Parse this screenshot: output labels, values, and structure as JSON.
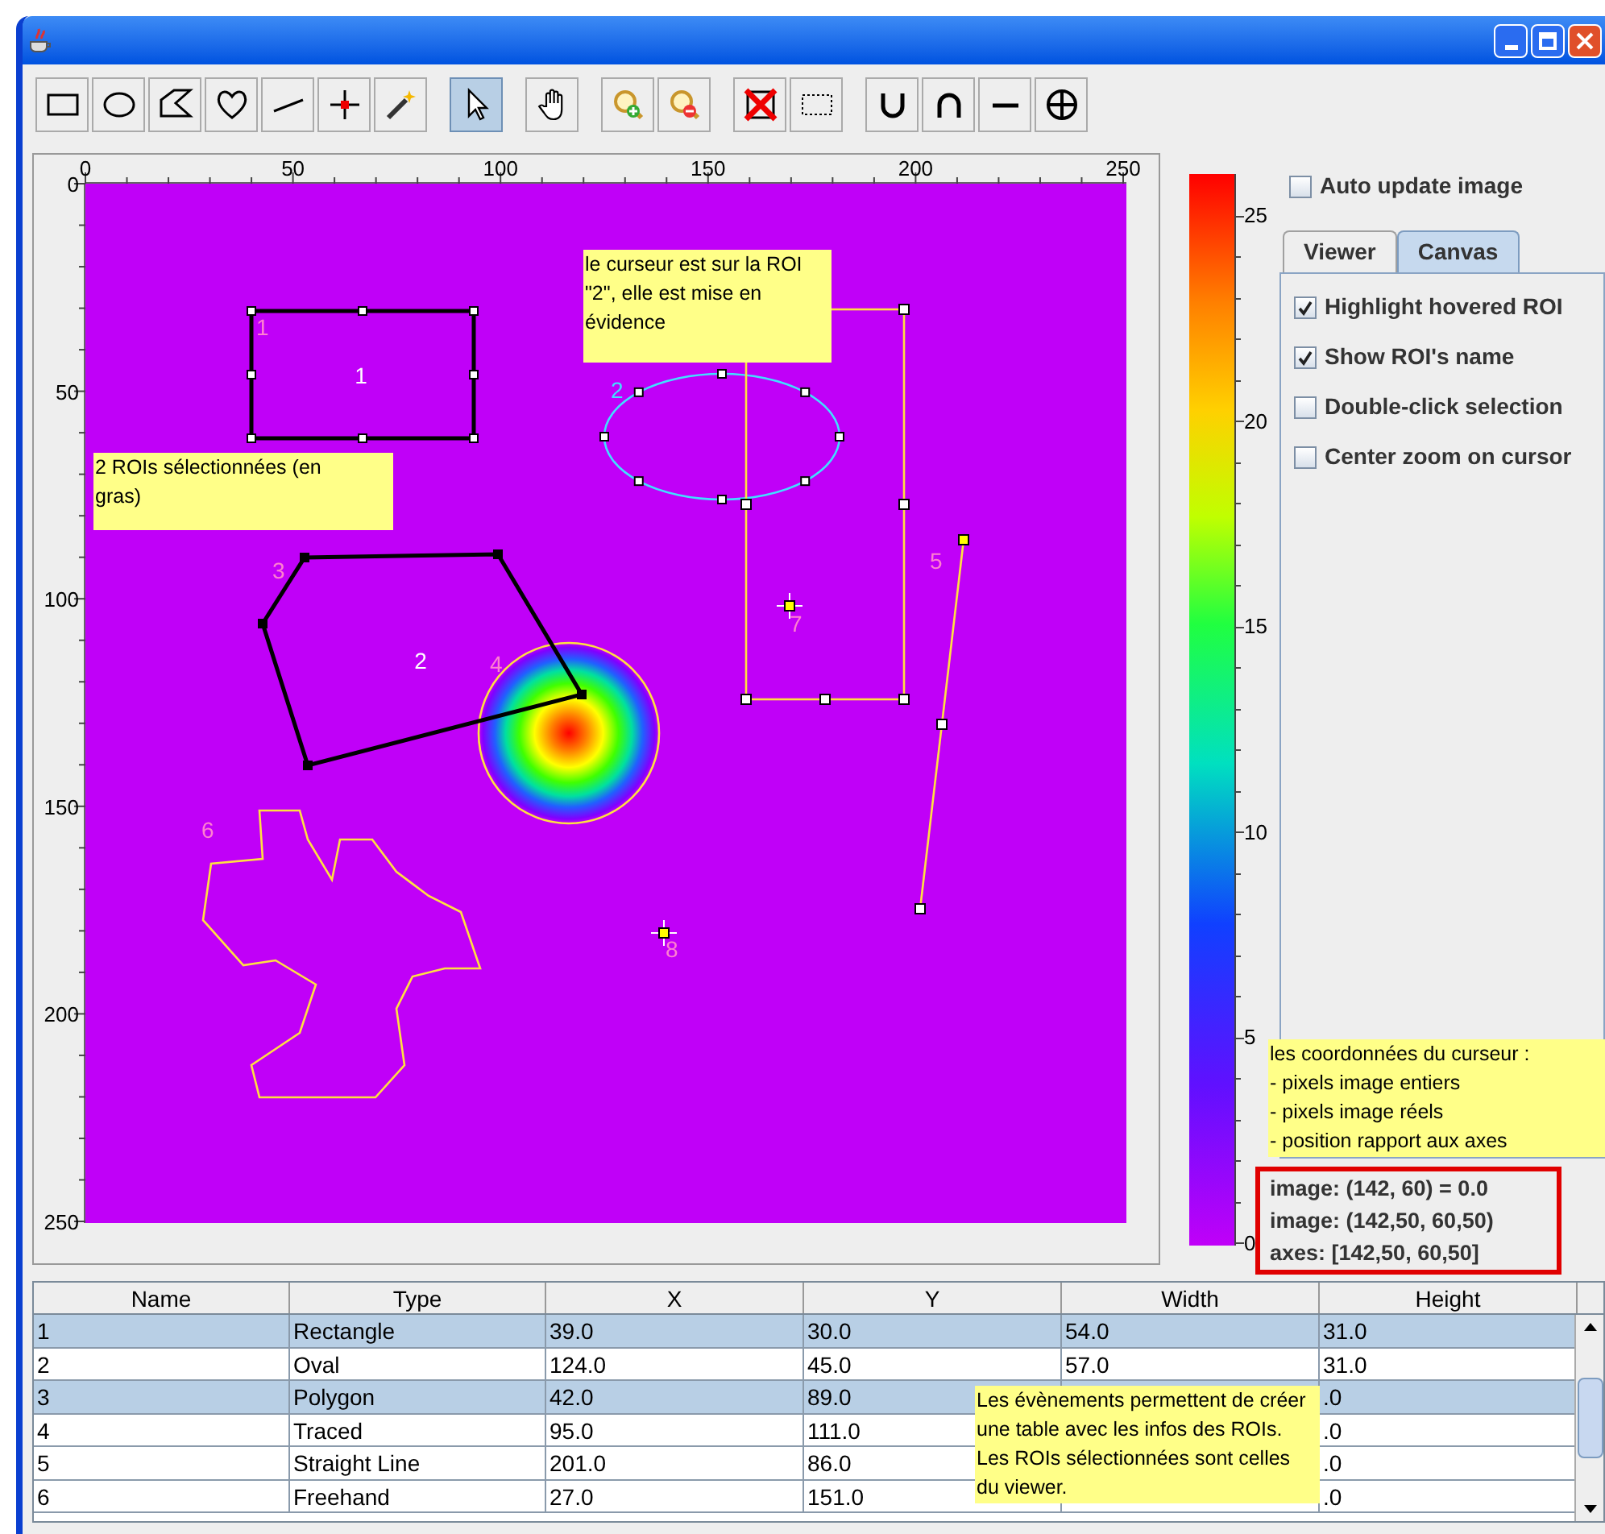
{
  "toolbar": {
    "groups": [
      [
        {
          "kind": "rectangle",
          "selected": false
        },
        {
          "kind": "oval",
          "selected": false
        },
        {
          "kind": "polygon",
          "selected": false
        },
        {
          "kind": "freehand",
          "selected": false
        },
        {
          "kind": "line",
          "selected": false
        },
        {
          "kind": "point",
          "selected": false
        },
        {
          "kind": "wand",
          "selected": false
        }
      ],
      [
        {
          "kind": "pointer",
          "selected": true
        }
      ],
      [
        {
          "kind": "hand",
          "selected": false
        }
      ],
      [
        {
          "kind": "zoom-in",
          "selected": false
        },
        {
          "kind": "zoom-out",
          "selected": false
        }
      ],
      [
        {
          "kind": "delete",
          "selected": false
        },
        {
          "kind": "select-rect",
          "selected": false
        }
      ],
      [
        {
          "kind": "union",
          "selected": false
        },
        {
          "kind": "intersection",
          "selected": false
        },
        {
          "kind": "minus",
          "selected": false
        },
        {
          "kind": "xor",
          "selected": false
        }
      ]
    ]
  },
  "viewer": {
    "x_ticks": [
      "0",
      "50",
      "100",
      "150",
      "200",
      "250"
    ],
    "y_ticks": [
      "0",
      "50",
      "100",
      "150",
      "200",
      "250"
    ],
    "rois": [
      {
        "kind": "rectangle",
        "name": "1",
        "center_label": "1",
        "selected": true,
        "highlighted": false
      },
      {
        "kind": "oval",
        "name": "2",
        "selected": false,
        "highlighted": true
      },
      {
        "kind": "polygon",
        "name": "3",
        "center_label": "2",
        "selected": true,
        "highlighted": false
      },
      {
        "kind": "traced",
        "name": "4",
        "selected": false,
        "highlighted": false
      },
      {
        "kind": "line",
        "name": "5",
        "selected": false,
        "highlighted": false
      },
      {
        "kind": "freehand",
        "name": "6",
        "selected": false,
        "highlighted": false
      },
      {
        "kind": "point",
        "name": "7",
        "selected": false,
        "highlighted": false
      },
      {
        "kind": "point",
        "name": "8",
        "selected": false,
        "highlighted": false
      },
      {
        "kind": "rectangle",
        "selected": false,
        "highlighted": false
      }
    ]
  },
  "colorbar": {
    "ticks": [
      "25",
      "20",
      "15",
      "10",
      "5",
      "0"
    ]
  },
  "options": {
    "auto_update": {
      "label": "Auto update image",
      "checked": false
    },
    "tabs": [
      {
        "label": "Viewer",
        "selected": false
      },
      {
        "label": "Canvas",
        "selected": true
      }
    ],
    "checkboxes": [
      {
        "label": "Highlight hovered ROI",
        "checked": true
      },
      {
        "label": "Show ROI's name",
        "checked": true
      },
      {
        "label": "Double-click selection",
        "checked": false
      },
      {
        "label": "Center zoom on cursor",
        "checked": false
      }
    ]
  },
  "cursor_info": [
    "image: (142, 60) = 0.0",
    "image: (142,50, 60,50)",
    "axes: [142,50, 60,50]"
  ],
  "notes": [
    {
      "kind": "selection",
      "lines": [
        "2 ROIs sélectionnées (en",
        "gras)"
      ]
    },
    {
      "kind": "hover",
      "lines": [
        "le curseur est sur la ROI",
        "\"2\", elle est mise en",
        "évidence"
      ]
    },
    {
      "kind": "coords",
      "lines": [
        "les coordonnées du curseur :",
        "- pixels image entiers",
        "- pixels image réels",
        "- position rapport aux axes"
      ]
    },
    {
      "kind": "table",
      "lines": [
        "Les évènements permettent de créer",
        "une table avec les infos des ROIs.",
        "Les ROIs sélectionnées sont celles",
        "du viewer."
      ]
    }
  ],
  "table": {
    "columns": [
      "Name",
      "Type",
      "X",
      "Y",
      "Width",
      "Height"
    ],
    "rows": [
      {
        "selected": true,
        "cells": [
          "1",
          "Rectangle",
          "39.0",
          "30.0",
          "54.0",
          "31.0"
        ]
      },
      {
        "selected": false,
        "cells": [
          "2",
          "Oval",
          "124.0",
          "45.0",
          "57.0",
          "31.0"
        ]
      },
      {
        "selected": true,
        "cells": [
          "3",
          "Polygon",
          "42.0",
          "89.0",
          null,
          ".0"
        ]
      },
      {
        "selected": false,
        "cells": [
          "4",
          "Traced",
          "95.0",
          "111.0",
          null,
          ".0"
        ]
      },
      {
        "selected": false,
        "cells": [
          "5",
          "Straight Line",
          "201.0",
          "86.0",
          null,
          ".0"
        ]
      },
      {
        "selected": false,
        "cells": [
          "6",
          "Freehand",
          "27.0",
          "151.0",
          null,
          ".0"
        ]
      }
    ]
  }
}
